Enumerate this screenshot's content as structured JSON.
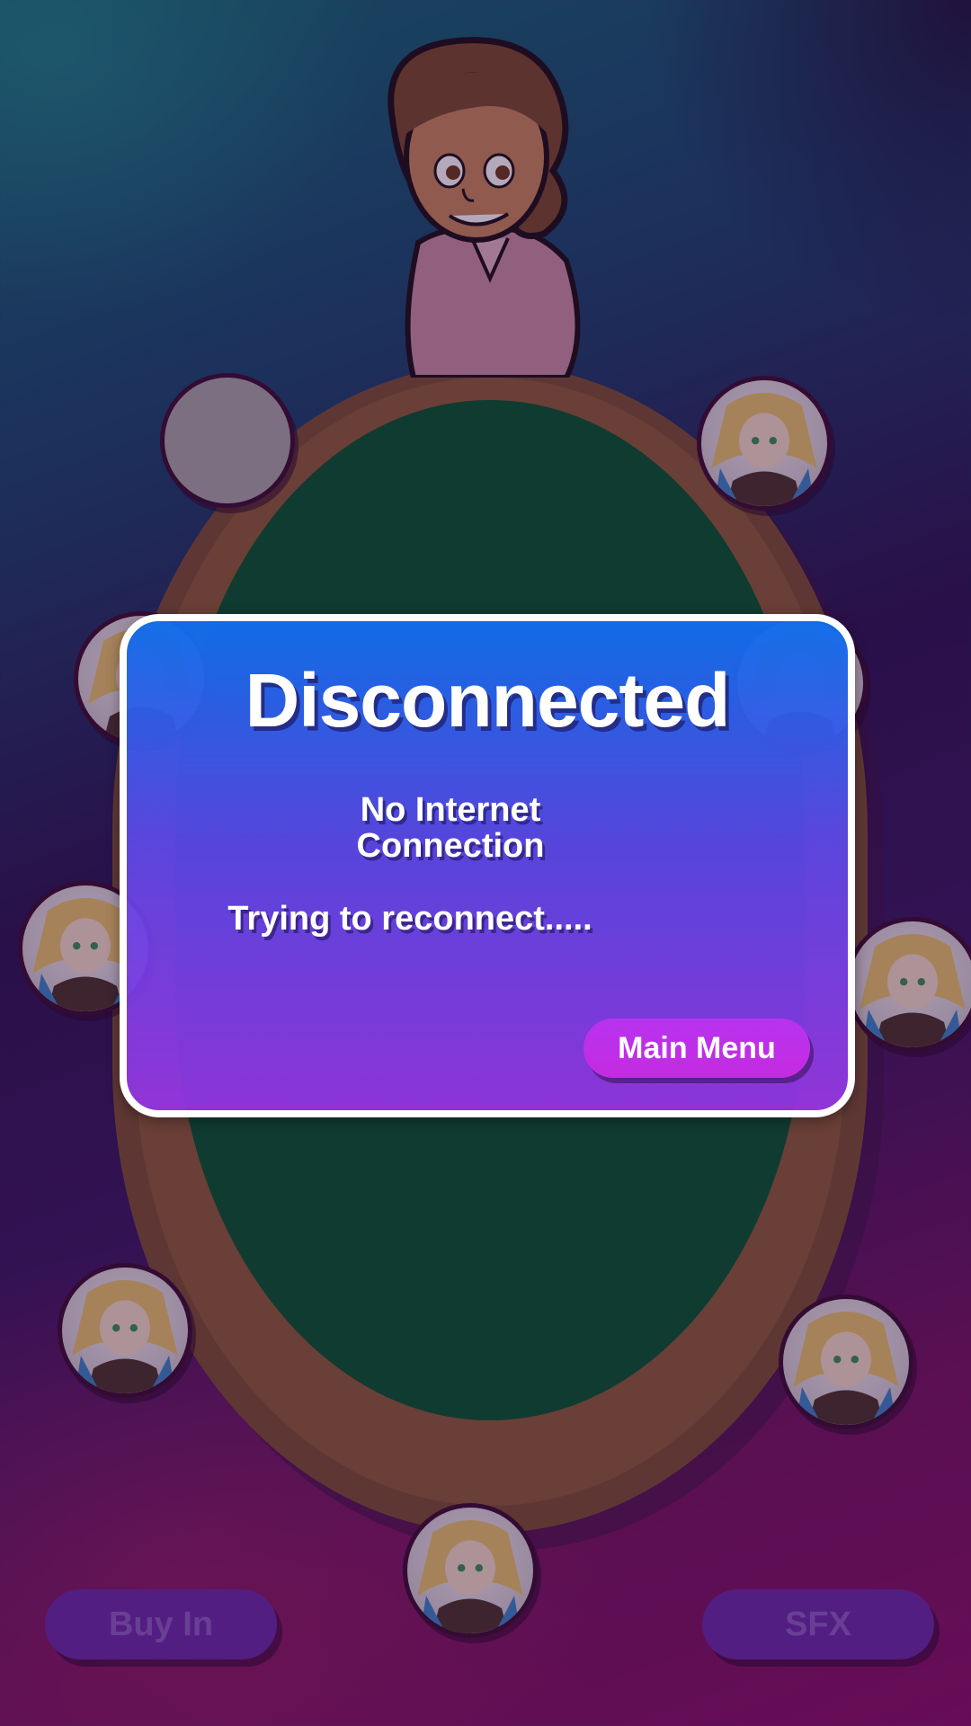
{
  "colors": {
    "felt": "#04562a",
    "table_rim": "#8c5c35",
    "dialog_top": "#106eeb",
    "dialog_bottom": "#9434e2",
    "main_menu_button": "#c42be0",
    "bottom_button": "#6a2aa8"
  },
  "scene": {
    "dealer_icon": "dealer-character",
    "seats": [
      {
        "id": "seat-top-left",
        "state": "empty"
      },
      {
        "id": "seat-top-right",
        "state": "occupied"
      },
      {
        "id": "seat-mid-left-upper",
        "state": "occupied"
      },
      {
        "id": "seat-mid-right-upper",
        "state": "occupied"
      },
      {
        "id": "seat-mid-left",
        "state": "occupied"
      },
      {
        "id": "seat-mid-right",
        "state": "occupied"
      },
      {
        "id": "seat-bottom-left",
        "state": "occupied"
      },
      {
        "id": "seat-bottom-right",
        "state": "occupied"
      },
      {
        "id": "seat-bottom-center",
        "state": "occupied"
      }
    ]
  },
  "controls": {
    "buy_in_label": "Buy In",
    "sfx_label": "SFX"
  },
  "dialog": {
    "title": "Disconnected",
    "message": "No Internet Connection",
    "status": "Trying to reconnect.....",
    "main_menu_label": "Main Menu"
  }
}
